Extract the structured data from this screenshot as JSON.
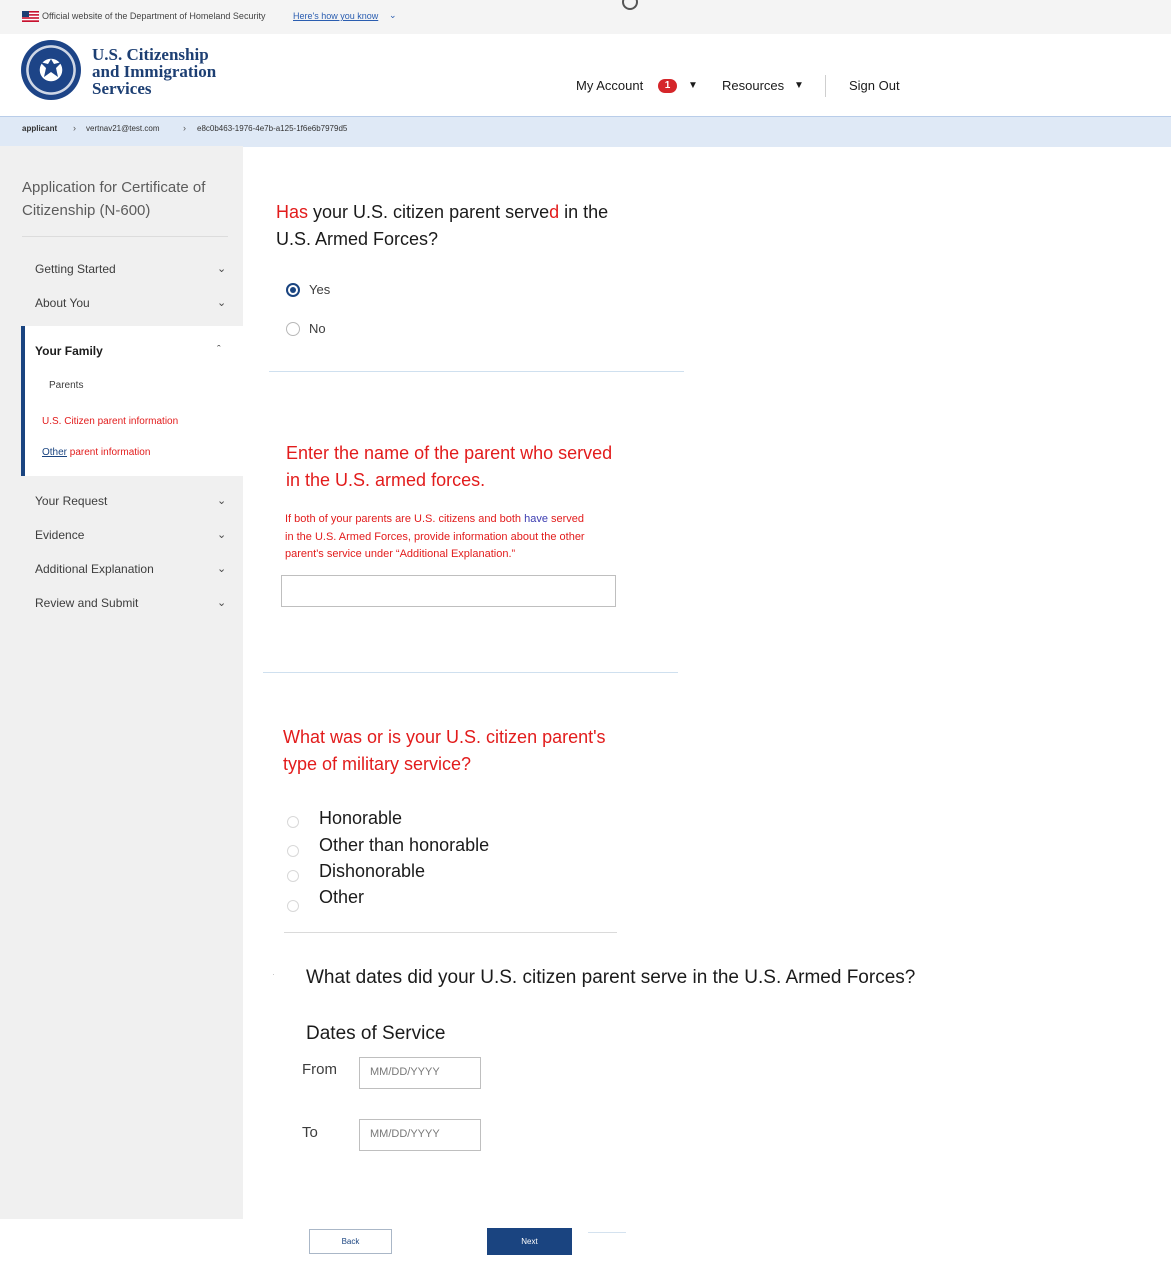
{
  "gov_banner": {
    "text": "Official website of the Department of Homeland Security",
    "link": "Here's how you know"
  },
  "header": {
    "logo_lines": [
      "U.S. Citizenship",
      "and Immigration",
      "Services"
    ],
    "nav": {
      "my_account": "My Account",
      "badge_count": "1",
      "resources": "Resources",
      "sign_out": "Sign Out"
    }
  },
  "breadcrumb": {
    "items": [
      "applicant",
      "vertnav21@test.com",
      "e8c0b463-1976-4e7b-a125-1f6e6b7979d5"
    ]
  },
  "sidebar": {
    "title": "Application for Certificate of Citizenship (N-600)",
    "sections": [
      {
        "label": "Getting Started"
      },
      {
        "label": "About You"
      },
      {
        "label": "Your Family"
      },
      {
        "label": "Your Request"
      },
      {
        "label": "Evidence"
      },
      {
        "label": "Additional Explanation"
      },
      {
        "label": "Review and Submit"
      }
    ],
    "family_sub": {
      "parents": "Parents",
      "us_parent": "U.S. Citizen parent information",
      "other_a": "Other",
      "other_b": " parent information"
    }
  },
  "q1": {
    "w1": "Has",
    "w2": " your U.S. citizen parent serve",
    "w3": "d",
    "w4": " in the",
    "line2": "U.S. Armed Forces?",
    "options": [
      "Yes",
      "No"
    ],
    "selected": "Yes"
  },
  "q2": {
    "line1": "Enter the name of the parent who served",
    "line2": "in the U.S. armed forces.",
    "help1a": "If both of your parents are U.S. citizens and both ",
    "help1b": "have",
    "help1c": " served",
    "help2": "in the U.S. Armed Forces, provide information about the other",
    "help3": "parent's service under “Additional Explanation.”",
    "value": ""
  },
  "q3": {
    "line1": "What was or is your U.S. citizen parent's",
    "line2": "type of military service?",
    "options": [
      "Honorable",
      "Other than honorable",
      "Dishonorable",
      "Other"
    ]
  },
  "q4": {
    "question": "What dates did your U.S. citizen parent serve in the U.S. Armed Forces?",
    "legend": "Dates of Service",
    "from_label": "From",
    "to_label": "To",
    "placeholder": "MM/DD/YYYY"
  },
  "buttons": {
    "back": "Back",
    "next": "Next"
  },
  "colors": {
    "primary": "#1a4480",
    "alert_red": "#e21c1c",
    "badge": "#d5262a"
  }
}
